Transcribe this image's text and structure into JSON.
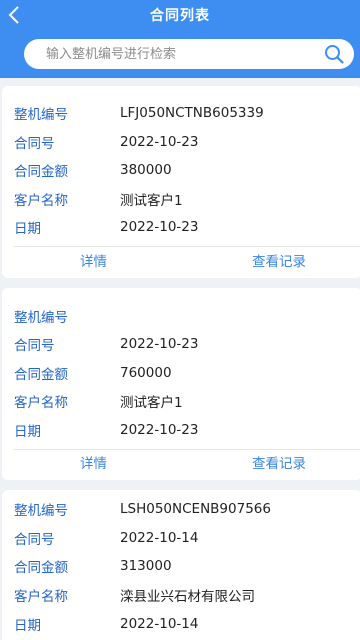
{
  "header": {
    "title": "合同列表",
    "back_icon": "chevron-left-icon"
  },
  "search": {
    "placeholder": "输入整机编号进行检索",
    "value": "",
    "icon": "search-icon"
  },
  "labels": {
    "machine_no": "整机编号",
    "contract_no": "合同号",
    "amount": "合同金额",
    "customer": "客户名称",
    "date": "日期",
    "detail": "详情",
    "records": "查看记录"
  },
  "contracts": [
    {
      "machine_no": "LFJ050NCTNB605339",
      "contract_no": "2022-10-23",
      "amount": "380000",
      "customer": "测试客户1",
      "date": "2022-10-23"
    },
    {
      "machine_no": "",
      "contract_no": "2022-10-23",
      "amount": "760000",
      "customer": "测试客户1",
      "date": "2022-10-23"
    },
    {
      "machine_no": "LSH050NCENB907566",
      "contract_no": "2022-10-14",
      "amount": "313000",
      "customer": "滦县业兴石材有限公司",
      "date": "2022-10-14"
    }
  ],
  "colors": {
    "header_bg": "#3d8ef0",
    "label": "#2566c8",
    "action": "#3a86e6",
    "page_bg": "#eef1f5"
  }
}
